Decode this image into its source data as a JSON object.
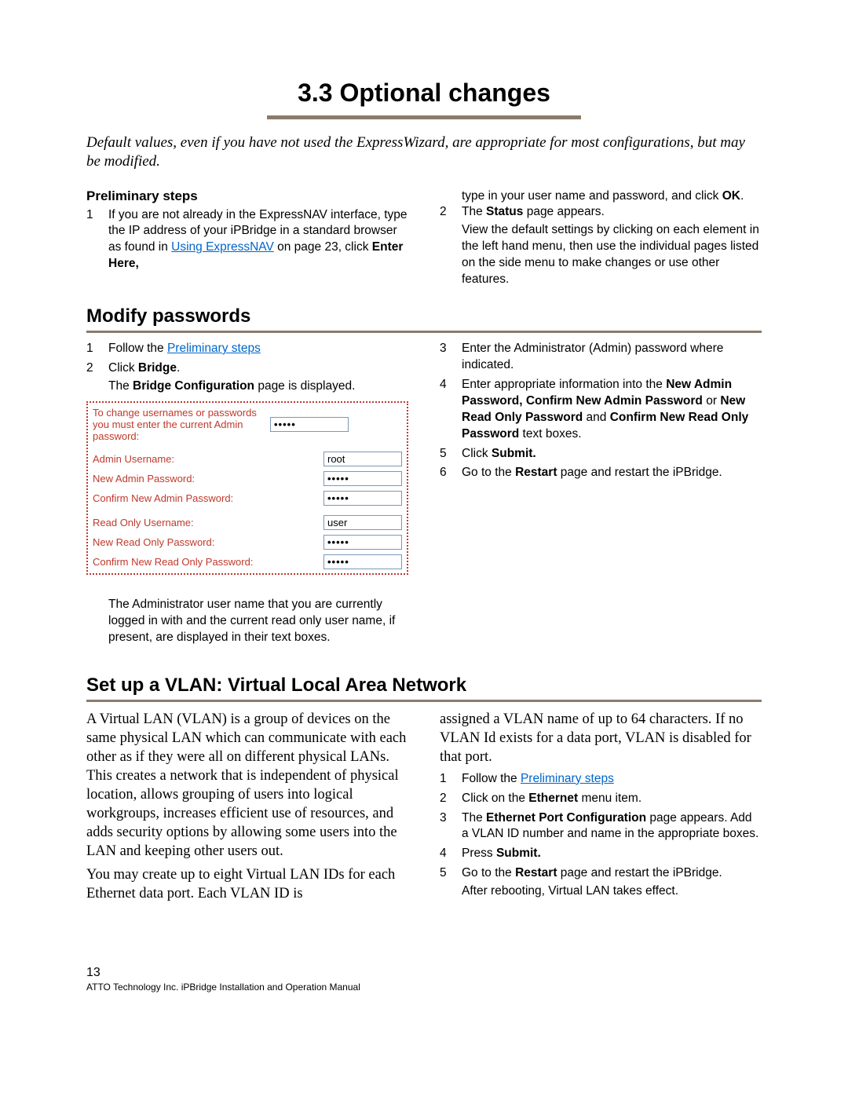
{
  "title": "3.3   Optional changes",
  "intro": "Default values, even if you have not used the ExpressWizard, are appropriate for most configurations, but may be modified.",
  "prelim": {
    "heading": "Preliminary steps",
    "step1_a": "If you are not already in the ExpressNAV interface, type the IP address of your iPBridge in a standard browser as found in ",
    "step1_link": "Using ExpressNAV",
    "step1_b": " on page 23, click ",
    "step1_bold": "Enter Here,",
    "right_cont": "type in your user name and password, and click ",
    "right_ok": "OK",
    "right_dot": ".",
    "step2_a": "The ",
    "step2_bold": "Status",
    "step2_b": " page appears.",
    "step2_sub": "View the default settings by clicking on each element in the left hand menu, then use the individual pages listed on the side menu to make changes or use other features."
  },
  "modify": {
    "heading": "Modify passwords",
    "left_s1_a": "Follow the ",
    "left_s1_link": "Preliminary steps",
    "left_s2_a": "Click ",
    "left_s2_bold": "Bridge",
    "left_s2_dot": ".",
    "left_s2_sub_a": "The ",
    "left_s2_sub_bold": "Bridge Configuration",
    "left_s2_sub_b": " page is displayed.",
    "form": {
      "t0": "To change usernames or passwords you must enter the current Admin password:",
      "r1": "Admin Username:",
      "r1v": "root",
      "r2": "New Admin Password:",
      "r3": "Confirm New Admin Password:",
      "r4": "Read Only Username:",
      "r4v": "user",
      "r5": "New Read Only Password:",
      "r6": "Confirm New Read Only Password:"
    },
    "left_note": "The Administrator user name that you are currently logged in with and the current read only user name, if present, are displayed in their text boxes.",
    "right_s3": "Enter the Administrator (Admin) password where indicated.",
    "right_s4_a": "Enter appropriate information into the ",
    "right_s4_b1": "New Admin Password, Confirm New Admin Password",
    "right_s4_or": " or ",
    "right_s4_b2": "New Read Only Password",
    "right_s4_and": " and ",
    "right_s4_b3": "Confirm New Read Only Password",
    "right_s4_tail": " text boxes.",
    "right_s5_a": "Click ",
    "right_s5_b": "Submit.",
    "right_s6_a": "Go to the ",
    "right_s6_b": "Restart",
    "right_s6_c": " page and restart the iPBridge."
  },
  "vlan": {
    "heading": "Set up a VLAN: Virtual Local Area Network",
    "left_p1": "A Virtual LAN (VLAN) is a group of devices on the same physical LAN which can communicate with each other as if they were all on different physical LANs. This creates a network that is independent of physical location, allows grouping of users into logical workgroups, increases efficient use of resources, and adds security options by allowing some users into the LAN and keeping other users out.",
    "left_p2": "You may create up to eight Virtual LAN IDs for each Ethernet data port. Each VLAN ID is",
    "right_p1": "assigned a VLAN name of up to 64 characters. If no VLAN Id exists for a data port, VLAN is disabled for that port.",
    "s1_a": "Follow the ",
    "s1_link": "Preliminary steps",
    "s2_a": "Click on the ",
    "s2_b": "Ethernet",
    "s2_c": " menu item.",
    "s3_a": "The ",
    "s3_b": "Ethernet Port Configuration",
    "s3_c": " page appears. Add a VLAN ID number and name in the appropriate boxes.",
    "s4_a": "Press ",
    "s4_b": "Submit.",
    "s5_a": "Go to the ",
    "s5_b": "Restart",
    "s5_c": " page and restart the iPBridge.",
    "s5_sub": "After rebooting, Virtual LAN takes effect."
  },
  "footer": {
    "page": "13",
    "line": "ATTO Technology Inc. iPBridge Installation and Operation Manual"
  }
}
